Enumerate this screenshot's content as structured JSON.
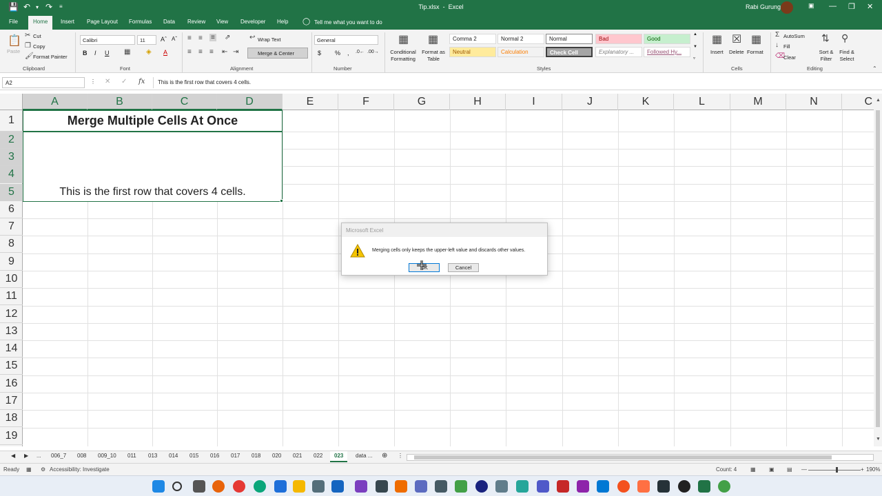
{
  "titlebar": {
    "filename": "Tip.xlsx",
    "app": "Excel",
    "separator": "-",
    "user": "Rabi Gurung"
  },
  "tabs": [
    "File",
    "Home",
    "Insert",
    "Page Layout",
    "Formulas",
    "Data",
    "Review",
    "View",
    "Developer",
    "Help"
  ],
  "tell_me": "Tell me what you want to do",
  "ribbon": {
    "clipboard": {
      "label": "Clipboard",
      "paste": "Paste",
      "cut": "Cut",
      "copy": "Copy",
      "format_painter": "Format Painter"
    },
    "font": {
      "label": "Font",
      "name": "Calibri",
      "size": "11"
    },
    "alignment": {
      "label": "Alignment",
      "wrap": "Wrap Text",
      "merge": "Merge & Center"
    },
    "number": {
      "label": "Number",
      "format": "General"
    },
    "styles": {
      "label": "Styles",
      "conditional": "Conditional Formatting",
      "format_table": "Format as Table",
      "cells": [
        {
          "name": "Comma 2",
          "bg": "#ffffff",
          "fg": "#222222"
        },
        {
          "name": "Normal 2",
          "bg": "#ffffff",
          "fg": "#222222"
        },
        {
          "name": "Normal",
          "bg": "#ffffff",
          "fg": "#222222"
        },
        {
          "name": "Bad",
          "bg": "#ffc7ce",
          "fg": "#9c0006"
        },
        {
          "name": "Good",
          "bg": "#c6efce",
          "fg": "#006100"
        },
        {
          "name": "Neutral",
          "bg": "#ffeb9c",
          "fg": "#9c5700"
        },
        {
          "name": "Calculation",
          "bg": "#f2f2f2",
          "fg": "#fa7d00"
        },
        {
          "name": "Check Cell",
          "bg": "#a5a5a5",
          "fg": "#ffffff"
        },
        {
          "name": "Explanatory ...",
          "bg": "#ffffff",
          "fg": "#7f7f7f"
        },
        {
          "name": "Followed Hy...",
          "bg": "#ffffff",
          "fg": "#954f72"
        }
      ]
    },
    "cells": {
      "label": "Cells",
      "insert": "Insert",
      "delete": "Delete",
      "format": "Format"
    },
    "editing": {
      "label": "Editing",
      "autosum": "AutoSum",
      "fill": "Fill",
      "clear": "Clear",
      "sort": "Sort & Filter",
      "find": "Find & Select"
    }
  },
  "formula_bar": {
    "name_box": "A2",
    "content": "This is the first row that covers 4 cells."
  },
  "columns": [
    "A",
    "B",
    "C",
    "D",
    "E",
    "F",
    "G",
    "H",
    "I",
    "J",
    "K",
    "L",
    "M",
    "N",
    "C"
  ],
  "rows": [
    "1",
    "2",
    "3",
    "4",
    "5",
    "6",
    "7",
    "8",
    "9",
    "10",
    "11",
    "12",
    "13",
    "14",
    "15",
    "16",
    "17",
    "18",
    "19"
  ],
  "cells": {
    "a1": "Merge Multiple Cells At Once",
    "a2": "This is the first row that covers 4 cells."
  },
  "sheets": [
    "...",
    "006_7",
    "008",
    "009_10",
    "011",
    "013",
    "014",
    "015",
    "016",
    "017",
    "018",
    "020",
    "021",
    "022",
    "023",
    "data ..."
  ],
  "active_sheet": "023",
  "status": {
    "ready": "Ready",
    "accessibility": "Accessibility: Investigate",
    "count": "Count: 4",
    "zoom": "190%"
  },
  "dialog": {
    "title": "Microsoft Excel",
    "message": "Merging cells only keeps the upper-left value and discards other values.",
    "ok": "OK",
    "cancel": "Cancel"
  },
  "colors": {
    "accent": "#217346"
  }
}
